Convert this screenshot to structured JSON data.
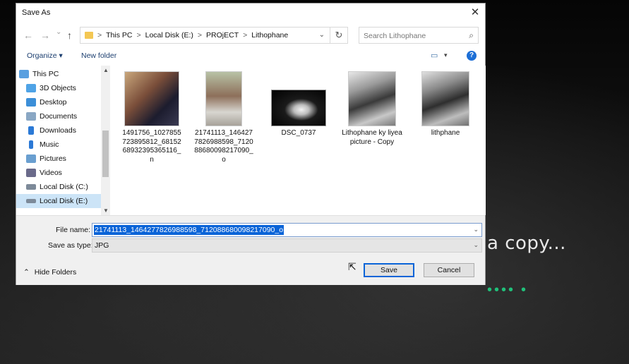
{
  "dialog": {
    "title": "Save As",
    "close_glyph": "✕"
  },
  "nav": {
    "back_glyph": "←",
    "forward_glyph": "→",
    "dropdown_glyph": "⌄",
    "up_glyph": "↑",
    "breadcrumb": [
      "This PC",
      "Local Disk (E:)",
      "PROjECT",
      "Lithophane"
    ],
    "breadcrumb_sep": ">",
    "refresh_glyph": "↻",
    "search_placeholder": "Search Lithophane",
    "search_glyph": "⌕"
  },
  "commands": {
    "organize": "Organize ▾",
    "new_folder": "New folder",
    "view_glyph": "▭",
    "view_drop_glyph": "▾",
    "help_glyph": "?"
  },
  "sidebar": {
    "items": [
      {
        "label": "This PC",
        "color": "#5aa0e0"
      },
      {
        "label": "3D Objects",
        "color": "#4fa3e6"
      },
      {
        "label": "Desktop",
        "color": "#3c8fd8"
      },
      {
        "label": "Documents",
        "color": "#8aa7c4"
      },
      {
        "label": "Downloads",
        "color": "#2b79d6"
      },
      {
        "label": "Music",
        "color": "#2b79d6"
      },
      {
        "label": "Pictures",
        "color": "#6a9fd0"
      },
      {
        "label": "Videos",
        "color": "#6a6a8a"
      },
      {
        "label": "Local Disk (C:)",
        "color": "#7d8a99"
      },
      {
        "label": "Local Disk (E:)",
        "color": "#7d8a99"
      }
    ],
    "scroll_up": "▲",
    "scroll_down": "▼"
  },
  "files": [
    {
      "name": "1491756_1027855723895812_6815268932395365116_n"
    },
    {
      "name": "21741113_1464277826988598_712088680098217090_o"
    },
    {
      "name": "DSC_0737"
    },
    {
      "name": "Lithophane ky liyea picture - Copy"
    },
    {
      "name": "lithphane"
    }
  ],
  "form": {
    "file_name_label": "File name:",
    "file_name_value": "21741113_1464277826988598_712088680098217090_o",
    "save_type_label": "Save as type:",
    "save_type_value": "JPG",
    "drop_glyph": "⌄",
    "hide_folders": "Hide Folders",
    "hide_glyph": "⌃",
    "save": "Save",
    "cancel": "Cancel"
  },
  "background": {
    "text": "a copy...",
    "dots": "••••",
    "dot": "•"
  }
}
